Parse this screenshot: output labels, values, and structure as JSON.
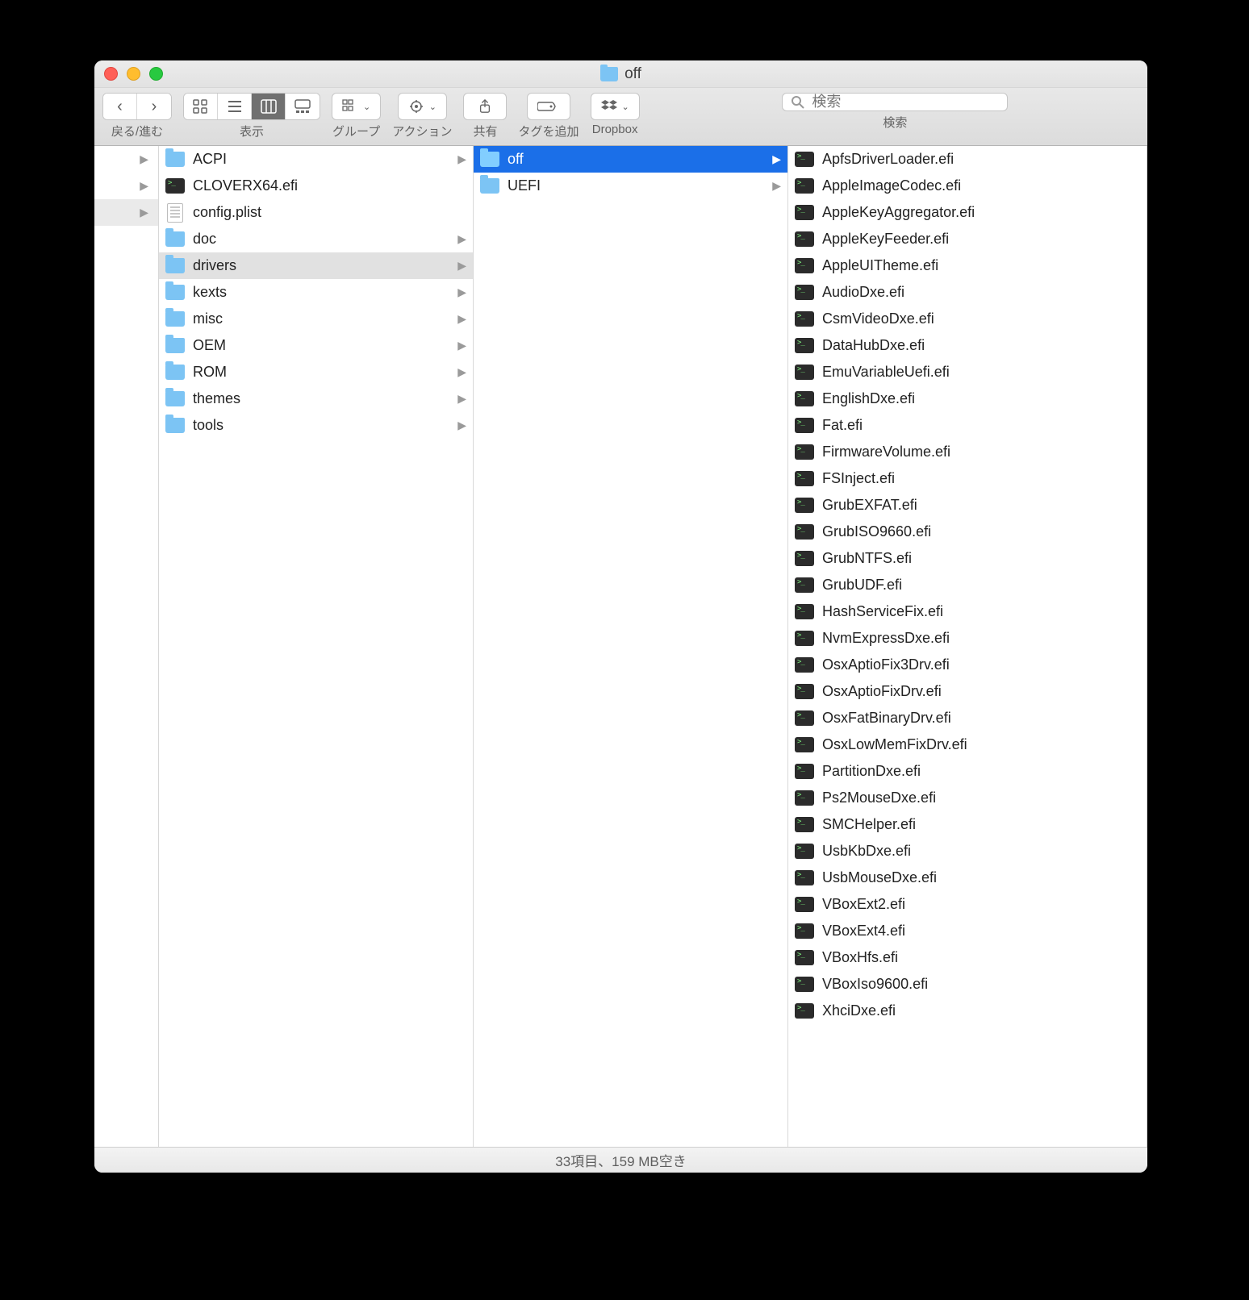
{
  "window": {
    "title": "off"
  },
  "toolbar": {
    "nav_label": "戻る/進む",
    "view_label": "表示",
    "group_label": "グループ",
    "action_label": "アクション",
    "share_label": "共有",
    "tag_label": "タグを追加",
    "dropbox_label": "Dropbox",
    "search_label": "検索",
    "search_placeholder": "検索"
  },
  "col0": {
    "rows": [
      {
        "blank": true
      },
      {
        "blank": true
      },
      {
        "blank": true,
        "sel": true
      }
    ]
  },
  "col1": [
    {
      "icon": "folder",
      "label": "ACPI",
      "arrow": true
    },
    {
      "icon": "exec",
      "label": "CLOVERX64.efi"
    },
    {
      "icon": "doc",
      "label": "config.plist"
    },
    {
      "icon": "folder",
      "label": "doc",
      "arrow": true
    },
    {
      "icon": "folder",
      "label": "drivers",
      "arrow": true,
      "sel": true
    },
    {
      "icon": "folder",
      "label": "kexts",
      "arrow": true
    },
    {
      "icon": "folder",
      "label": "misc",
      "arrow": true
    },
    {
      "icon": "folder",
      "label": "OEM",
      "arrow": true
    },
    {
      "icon": "folder",
      "label": "ROM",
      "arrow": true
    },
    {
      "icon": "folder",
      "label": "themes",
      "arrow": true
    },
    {
      "icon": "folder",
      "label": "tools",
      "arrow": true
    }
  ],
  "col2": [
    {
      "icon": "folder",
      "label": "off",
      "arrow": true,
      "selblue": true
    },
    {
      "icon": "folder",
      "label": "UEFI",
      "arrow": true
    }
  ],
  "col3": [
    {
      "icon": "exec",
      "label": "ApfsDriverLoader.efi"
    },
    {
      "icon": "exec",
      "label": "AppleImageCodec.efi"
    },
    {
      "icon": "exec",
      "label": "AppleKeyAggregator.efi"
    },
    {
      "icon": "exec",
      "label": "AppleKeyFeeder.efi"
    },
    {
      "icon": "exec",
      "label": "AppleUITheme.efi"
    },
    {
      "icon": "exec",
      "label": "AudioDxe.efi"
    },
    {
      "icon": "exec",
      "label": "CsmVideoDxe.efi"
    },
    {
      "icon": "exec",
      "label": "DataHubDxe.efi"
    },
    {
      "icon": "exec",
      "label": "EmuVariableUefi.efi"
    },
    {
      "icon": "exec",
      "label": "EnglishDxe.efi"
    },
    {
      "icon": "exec",
      "label": "Fat.efi"
    },
    {
      "icon": "exec",
      "label": "FirmwareVolume.efi"
    },
    {
      "icon": "exec",
      "label": "FSInject.efi"
    },
    {
      "icon": "exec",
      "label": "GrubEXFAT.efi"
    },
    {
      "icon": "exec",
      "label": "GrubISO9660.efi"
    },
    {
      "icon": "exec",
      "label": "GrubNTFS.efi"
    },
    {
      "icon": "exec",
      "label": "GrubUDF.efi"
    },
    {
      "icon": "exec",
      "label": "HashServiceFix.efi"
    },
    {
      "icon": "exec",
      "label": "NvmExpressDxe.efi"
    },
    {
      "icon": "exec",
      "label": "OsxAptioFix3Drv.efi"
    },
    {
      "icon": "exec",
      "label": "OsxAptioFixDrv.efi"
    },
    {
      "icon": "exec",
      "label": "OsxFatBinaryDrv.efi"
    },
    {
      "icon": "exec",
      "label": "OsxLowMemFixDrv.efi"
    },
    {
      "icon": "exec",
      "label": "PartitionDxe.efi"
    },
    {
      "icon": "exec",
      "label": "Ps2MouseDxe.efi"
    },
    {
      "icon": "exec",
      "label": "SMCHelper.efi"
    },
    {
      "icon": "exec",
      "label": "UsbKbDxe.efi"
    },
    {
      "icon": "exec",
      "label": "UsbMouseDxe.efi"
    },
    {
      "icon": "exec",
      "label": "VBoxExt2.efi"
    },
    {
      "icon": "exec",
      "label": "VBoxExt4.efi"
    },
    {
      "icon": "exec",
      "label": "VBoxHfs.efi"
    },
    {
      "icon": "exec",
      "label": "VBoxIso9600.efi"
    },
    {
      "icon": "exec",
      "label": "XhciDxe.efi"
    }
  ],
  "status": "33項目、159 MB空き"
}
